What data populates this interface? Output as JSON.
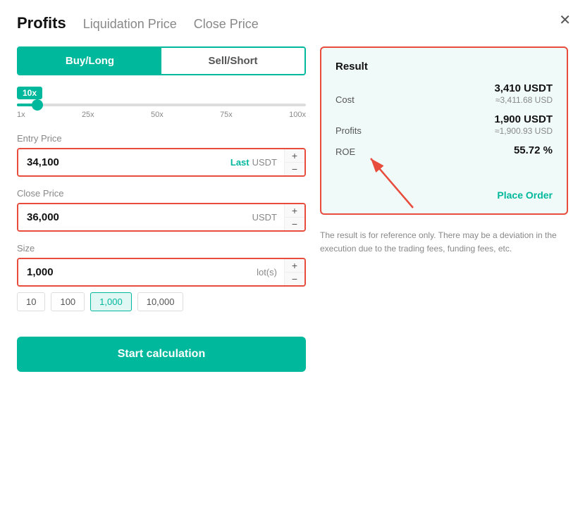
{
  "modal": {
    "close_label": "✕"
  },
  "tabs": [
    {
      "id": "profits",
      "label": "Profits",
      "active": true
    },
    {
      "id": "liquidation",
      "label": "Liquidation Price",
      "active": false
    },
    {
      "id": "close",
      "label": "Close Price",
      "active": false
    }
  ],
  "toggle": {
    "buy_label": "Buy/Long",
    "sell_label": "Sell/Short"
  },
  "leverage": {
    "badge": "10x",
    "marks": [
      "1x",
      "25x",
      "50x",
      "75x",
      "100x"
    ]
  },
  "entry_price": {
    "label": "Entry Price",
    "value": "34,100",
    "unit_last": "Last",
    "unit": "USDT"
  },
  "close_price": {
    "label": "Close Price",
    "value": "36,000",
    "unit": "USDT"
  },
  "size": {
    "label": "Size",
    "value": "1,000",
    "unit": "lot(s)",
    "options": [
      "10",
      "100",
      "1,000",
      "10,000"
    ]
  },
  "calc_button": "Start calculation",
  "result": {
    "title": "Result",
    "cost_label": "Cost",
    "cost_main": "3,410 USDT",
    "cost_sub": "≈3,411.68 USD",
    "profits_label": "Profits",
    "profits_main": "1,900 USDT",
    "profits_sub": "≈1,900.93 USD",
    "roe_label": "ROE",
    "roe_main": "55.72 %",
    "place_order": "Place Order",
    "disclaimer": "The result is for reference only. There may be a deviation in the execution due to the trading fees, funding fees, etc."
  }
}
